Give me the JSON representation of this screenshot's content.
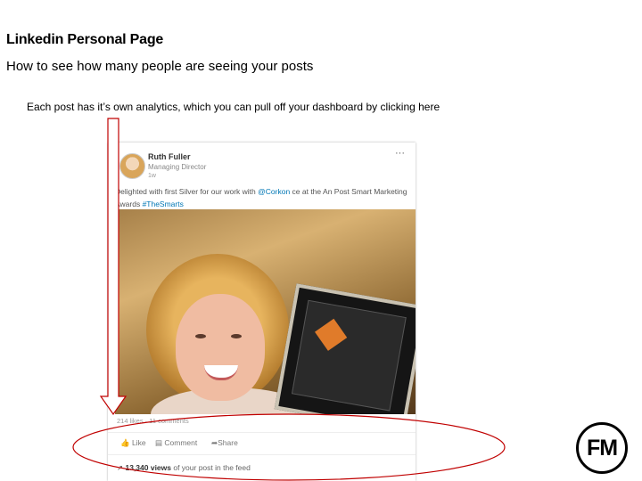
{
  "slide": {
    "title": "Linkedin Personal Page",
    "subtitle": "How to see how many people are seeing your posts",
    "note": "Each post has it’s own analytics, which you can pull off your dashboard by clicking here"
  },
  "post": {
    "author": "Ruth Fuller",
    "role": "Managing Director",
    "time": "1w",
    "more": "···",
    "text_prefix": "Delighted with first Silver for our work with ",
    "mention": "@Corkon",
    "text_middle": " ce at the An Post Smart Marketing Awards ",
    "hashtag": "#TheSmarts",
    "stats": "214 likes · 11 comments",
    "actions": {
      "like": "Like",
      "comment": "Comment",
      "share": "Share"
    },
    "views_count": "13,340 views",
    "views_suffix": " of your post in the feed"
  },
  "logo_text": "FM",
  "colors": {
    "link": "#0077b5",
    "annotation": "#c00000"
  }
}
